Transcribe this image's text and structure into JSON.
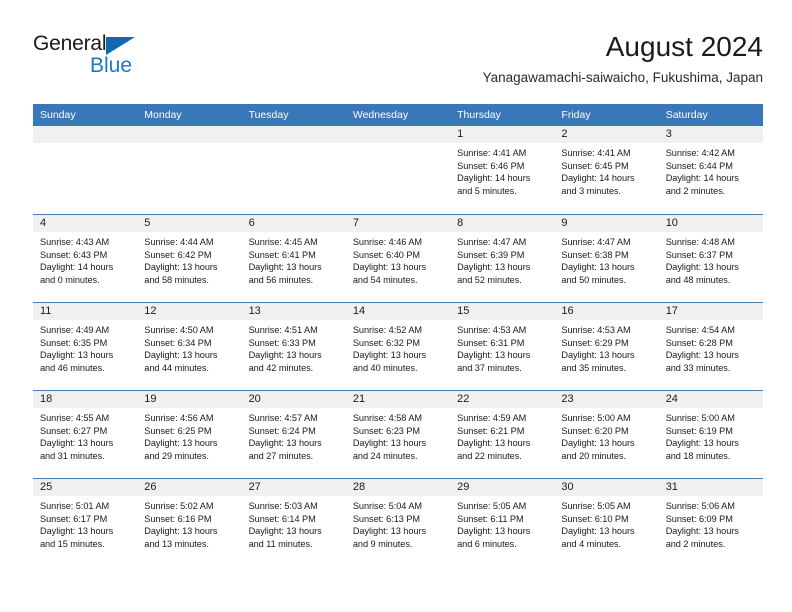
{
  "brand": {
    "name_part1": "General",
    "name_part2": "Blue",
    "triangle_icon": "triangle-icon",
    "color_dark": "#1b1b1b",
    "color_blue": "#1979c8"
  },
  "header": {
    "title": "August 2024",
    "subtitle": "Yanagawamachi-saiwaicho, Fukushima, Japan"
  },
  "theme": {
    "header_blue": "#3a77b8",
    "day_band_gray": "#f0f0f0",
    "row_rule": "#4f7ea8"
  },
  "calendar": {
    "day_headers": [
      "Sunday",
      "Monday",
      "Tuesday",
      "Wednesday",
      "Thursday",
      "Friday",
      "Saturday"
    ],
    "weeks": [
      [
        {
          "day": "",
          "lines": []
        },
        {
          "day": "",
          "lines": []
        },
        {
          "day": "",
          "lines": []
        },
        {
          "day": "",
          "lines": []
        },
        {
          "day": "1",
          "lines": [
            "Sunrise: 4:41 AM",
            "Sunset: 6:46 PM",
            "Daylight: 14 hours",
            "and 5 minutes."
          ]
        },
        {
          "day": "2",
          "lines": [
            "Sunrise: 4:41 AM",
            "Sunset: 6:45 PM",
            "Daylight: 14 hours",
            "and 3 minutes."
          ]
        },
        {
          "day": "3",
          "lines": [
            "Sunrise: 4:42 AM",
            "Sunset: 6:44 PM",
            "Daylight: 14 hours",
            "and 2 minutes."
          ]
        }
      ],
      [
        {
          "day": "4",
          "lines": [
            "Sunrise: 4:43 AM",
            "Sunset: 6:43 PM",
            "Daylight: 14 hours",
            "and 0 minutes."
          ]
        },
        {
          "day": "5",
          "lines": [
            "Sunrise: 4:44 AM",
            "Sunset: 6:42 PM",
            "Daylight: 13 hours",
            "and 58 minutes."
          ]
        },
        {
          "day": "6",
          "lines": [
            "Sunrise: 4:45 AM",
            "Sunset: 6:41 PM",
            "Daylight: 13 hours",
            "and 56 minutes."
          ]
        },
        {
          "day": "7",
          "lines": [
            "Sunrise: 4:46 AM",
            "Sunset: 6:40 PM",
            "Daylight: 13 hours",
            "and 54 minutes."
          ]
        },
        {
          "day": "8",
          "lines": [
            "Sunrise: 4:47 AM",
            "Sunset: 6:39 PM",
            "Daylight: 13 hours",
            "and 52 minutes."
          ]
        },
        {
          "day": "9",
          "lines": [
            "Sunrise: 4:47 AM",
            "Sunset: 6:38 PM",
            "Daylight: 13 hours",
            "and 50 minutes."
          ]
        },
        {
          "day": "10",
          "lines": [
            "Sunrise: 4:48 AM",
            "Sunset: 6:37 PM",
            "Daylight: 13 hours",
            "and 48 minutes."
          ]
        }
      ],
      [
        {
          "day": "11",
          "lines": [
            "Sunrise: 4:49 AM",
            "Sunset: 6:35 PM",
            "Daylight: 13 hours",
            "and 46 minutes."
          ]
        },
        {
          "day": "12",
          "lines": [
            "Sunrise: 4:50 AM",
            "Sunset: 6:34 PM",
            "Daylight: 13 hours",
            "and 44 minutes."
          ]
        },
        {
          "day": "13",
          "lines": [
            "Sunrise: 4:51 AM",
            "Sunset: 6:33 PM",
            "Daylight: 13 hours",
            "and 42 minutes."
          ]
        },
        {
          "day": "14",
          "lines": [
            "Sunrise: 4:52 AM",
            "Sunset: 6:32 PM",
            "Daylight: 13 hours",
            "and 40 minutes."
          ]
        },
        {
          "day": "15",
          "lines": [
            "Sunrise: 4:53 AM",
            "Sunset: 6:31 PM",
            "Daylight: 13 hours",
            "and 37 minutes."
          ]
        },
        {
          "day": "16",
          "lines": [
            "Sunrise: 4:53 AM",
            "Sunset: 6:29 PM",
            "Daylight: 13 hours",
            "and 35 minutes."
          ]
        },
        {
          "day": "17",
          "lines": [
            "Sunrise: 4:54 AM",
            "Sunset: 6:28 PM",
            "Daylight: 13 hours",
            "and 33 minutes."
          ]
        }
      ],
      [
        {
          "day": "18",
          "lines": [
            "Sunrise: 4:55 AM",
            "Sunset: 6:27 PM",
            "Daylight: 13 hours",
            "and 31 minutes."
          ]
        },
        {
          "day": "19",
          "lines": [
            "Sunrise: 4:56 AM",
            "Sunset: 6:25 PM",
            "Daylight: 13 hours",
            "and 29 minutes."
          ]
        },
        {
          "day": "20",
          "lines": [
            "Sunrise: 4:57 AM",
            "Sunset: 6:24 PM",
            "Daylight: 13 hours",
            "and 27 minutes."
          ]
        },
        {
          "day": "21",
          "lines": [
            "Sunrise: 4:58 AM",
            "Sunset: 6:23 PM",
            "Daylight: 13 hours",
            "and 24 minutes."
          ]
        },
        {
          "day": "22",
          "lines": [
            "Sunrise: 4:59 AM",
            "Sunset: 6:21 PM",
            "Daylight: 13 hours",
            "and 22 minutes."
          ]
        },
        {
          "day": "23",
          "lines": [
            "Sunrise: 5:00 AM",
            "Sunset: 6:20 PM",
            "Daylight: 13 hours",
            "and 20 minutes."
          ]
        },
        {
          "day": "24",
          "lines": [
            "Sunrise: 5:00 AM",
            "Sunset: 6:19 PM",
            "Daylight: 13 hours",
            "and 18 minutes."
          ]
        }
      ],
      [
        {
          "day": "25",
          "lines": [
            "Sunrise: 5:01 AM",
            "Sunset: 6:17 PM",
            "Daylight: 13 hours",
            "and 15 minutes."
          ]
        },
        {
          "day": "26",
          "lines": [
            "Sunrise: 5:02 AM",
            "Sunset: 6:16 PM",
            "Daylight: 13 hours",
            "and 13 minutes."
          ]
        },
        {
          "day": "27",
          "lines": [
            "Sunrise: 5:03 AM",
            "Sunset: 6:14 PM",
            "Daylight: 13 hours",
            "and 11 minutes."
          ]
        },
        {
          "day": "28",
          "lines": [
            "Sunrise: 5:04 AM",
            "Sunset: 6:13 PM",
            "Daylight: 13 hours",
            "and 9 minutes."
          ]
        },
        {
          "day": "29",
          "lines": [
            "Sunrise: 5:05 AM",
            "Sunset: 6:11 PM",
            "Daylight: 13 hours",
            "and 6 minutes."
          ]
        },
        {
          "day": "30",
          "lines": [
            "Sunrise: 5:05 AM",
            "Sunset: 6:10 PM",
            "Daylight: 13 hours",
            "and 4 minutes."
          ]
        },
        {
          "day": "31",
          "lines": [
            "Sunrise: 5:06 AM",
            "Sunset: 6:09 PM",
            "Daylight: 13 hours",
            "and 2 minutes."
          ]
        }
      ]
    ]
  }
}
